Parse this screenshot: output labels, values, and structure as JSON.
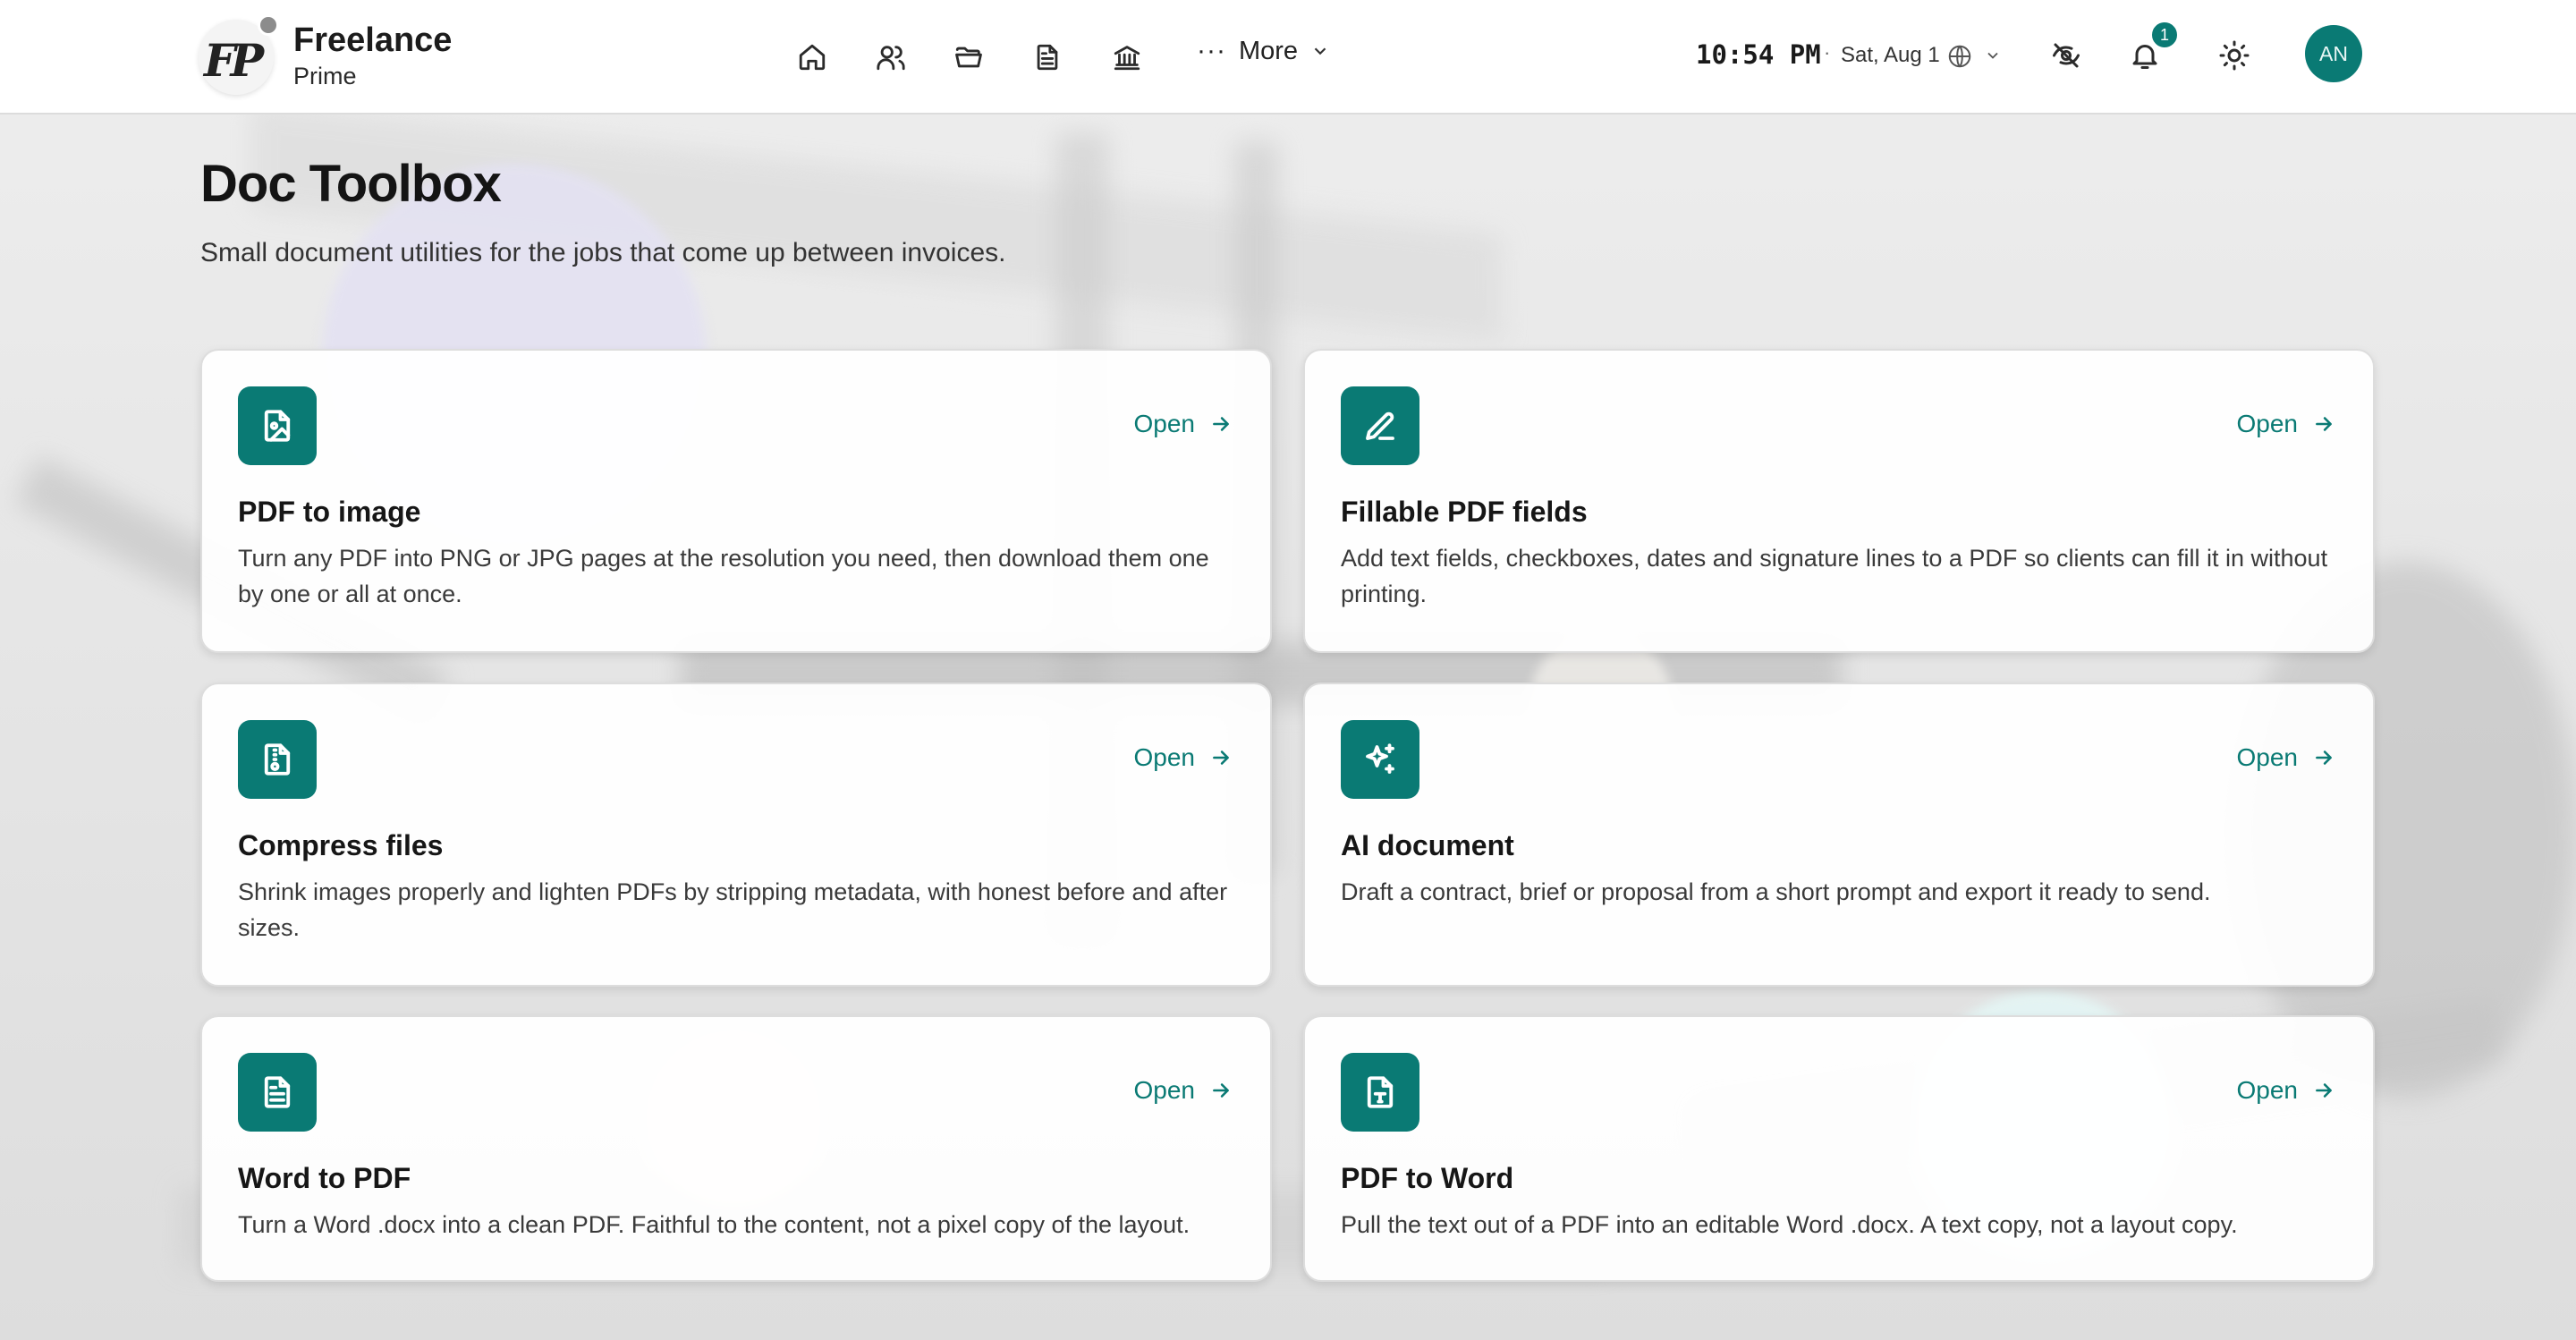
{
  "brand": {
    "name": "Freelance",
    "sub": "Prime",
    "mark": "FP"
  },
  "nav": {
    "icons": [
      "home-icon",
      "users-icon",
      "folder-icon",
      "document-icon",
      "bank-icon"
    ],
    "more_label": "More"
  },
  "status": {
    "time": "10:54 PM",
    "date": "Sat, Aug 1",
    "notification_count": "1",
    "avatar_initials": "AN"
  },
  "page": {
    "title": "Doc Toolbox",
    "subtitle": "Small document utilities for the jobs that come up between invoices."
  },
  "tools": [
    {
      "title": "PDF to image",
      "description": "Turn any PDF into PNG or JPG pages at the resolution you need, then download them one by one or all at once.",
      "open_label": "Open",
      "icon": "file-image-icon"
    },
    {
      "title": "Fillable PDF fields",
      "description": "Add text fields, checkboxes, dates and signature lines to a PDF so clients can fill it in without printing.",
      "open_label": "Open",
      "icon": "pen-icon"
    },
    {
      "title": "Compress files",
      "description": "Shrink images properly and lighten PDFs by stripping metadata, with honest before and after sizes.",
      "open_label": "Open",
      "icon": "file-archive-icon"
    },
    {
      "title": "AI document",
      "description": "Draft a contract, brief or proposal from a short prompt and export it ready to send.",
      "open_label": "Open",
      "icon": "sparkles-icon"
    },
    {
      "title": "Word to PDF",
      "description": "Turn a Word .docx into a clean PDF. Faithful to the content, not a pixel copy of the layout.",
      "open_label": "Open",
      "icon": "file-text-icon"
    },
    {
      "title": "PDF to Word",
      "description": "Pull the text out of a PDF into an editable Word .docx. A text copy, not a layout copy.",
      "open_label": "Open",
      "icon": "file-type-icon"
    }
  ],
  "colors": {
    "accent": "#0a7a74",
    "background": "#e8e8e8",
    "card": "#ffffff"
  }
}
